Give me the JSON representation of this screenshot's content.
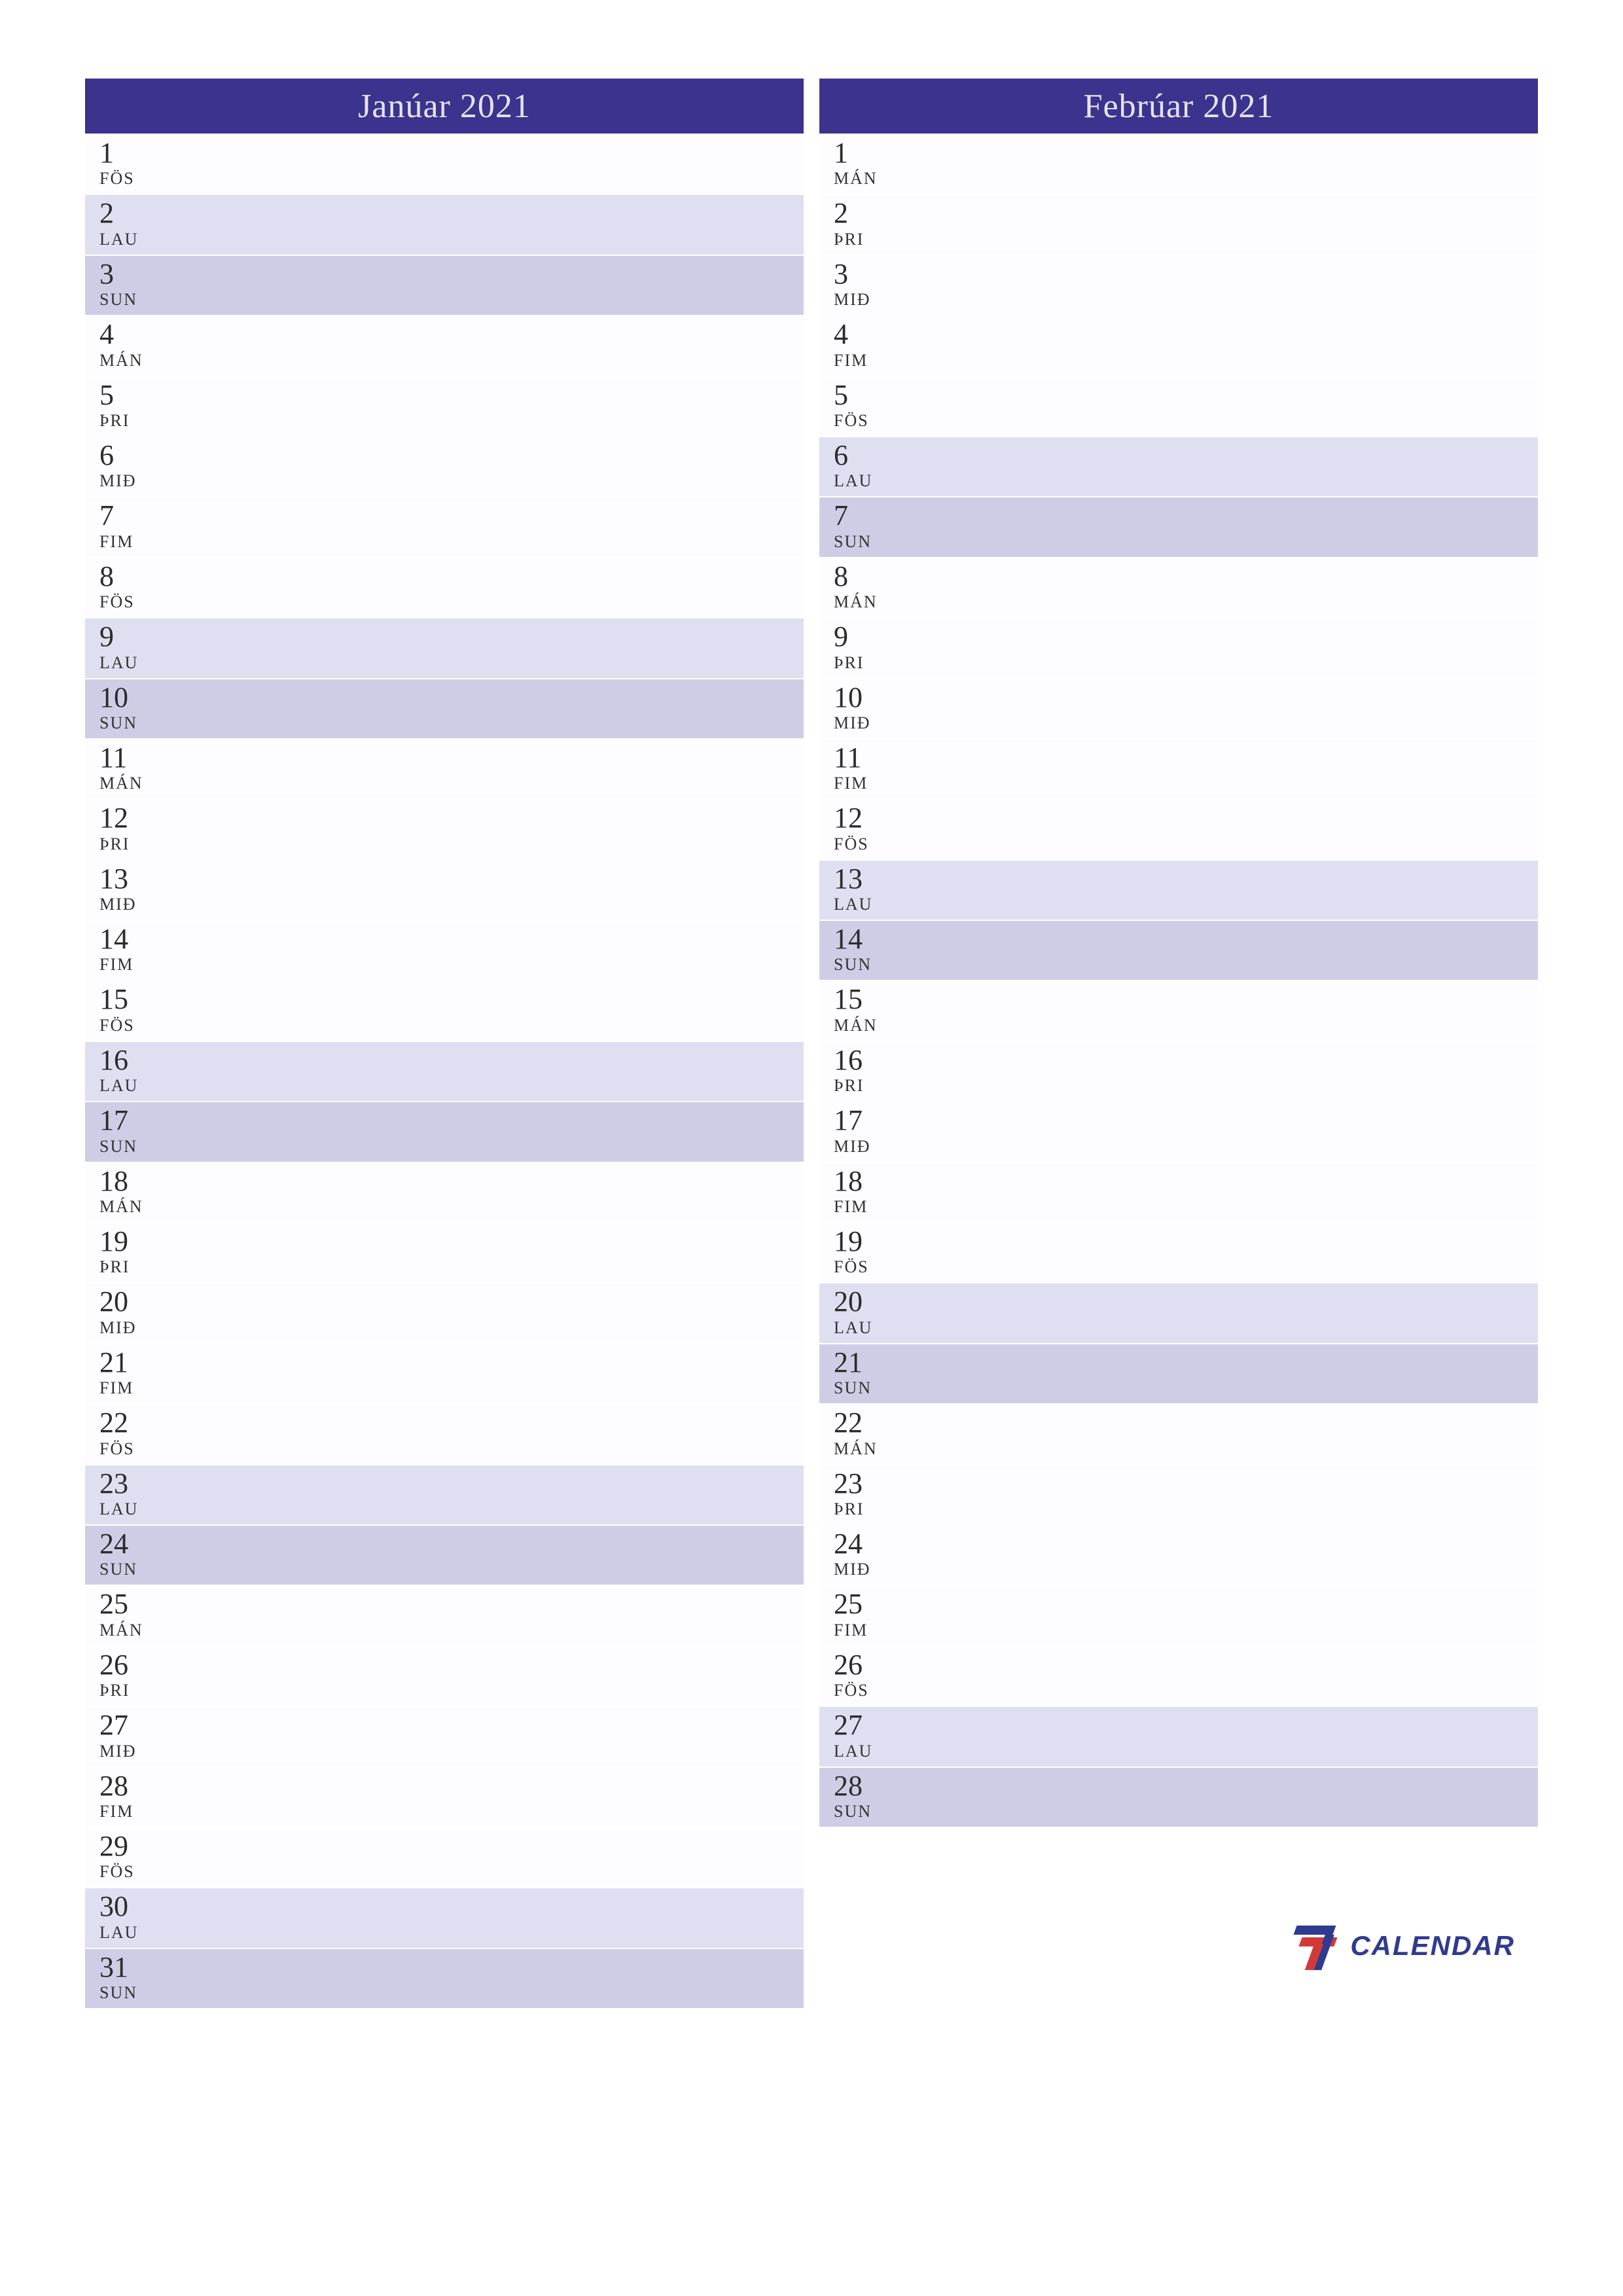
{
  "brand": {
    "text": "CALENDAR"
  },
  "months": [
    {
      "title": "Janúar 2021",
      "days": [
        {
          "num": "1",
          "dow": "FÖS",
          "type": "work"
        },
        {
          "num": "2",
          "dow": "LAU",
          "type": "sat"
        },
        {
          "num": "3",
          "dow": "SUN",
          "type": "sun"
        },
        {
          "num": "4",
          "dow": "MÁN",
          "type": "work"
        },
        {
          "num": "5",
          "dow": "ÞRI",
          "type": "work"
        },
        {
          "num": "6",
          "dow": "MIÐ",
          "type": "work"
        },
        {
          "num": "7",
          "dow": "FIM",
          "type": "work"
        },
        {
          "num": "8",
          "dow": "FÖS",
          "type": "work"
        },
        {
          "num": "9",
          "dow": "LAU",
          "type": "sat"
        },
        {
          "num": "10",
          "dow": "SUN",
          "type": "sun"
        },
        {
          "num": "11",
          "dow": "MÁN",
          "type": "work"
        },
        {
          "num": "12",
          "dow": "ÞRI",
          "type": "work"
        },
        {
          "num": "13",
          "dow": "MIÐ",
          "type": "work"
        },
        {
          "num": "14",
          "dow": "FIM",
          "type": "work"
        },
        {
          "num": "15",
          "dow": "FÖS",
          "type": "work"
        },
        {
          "num": "16",
          "dow": "LAU",
          "type": "sat"
        },
        {
          "num": "17",
          "dow": "SUN",
          "type": "sun"
        },
        {
          "num": "18",
          "dow": "MÁN",
          "type": "work"
        },
        {
          "num": "19",
          "dow": "ÞRI",
          "type": "work"
        },
        {
          "num": "20",
          "dow": "MIÐ",
          "type": "work"
        },
        {
          "num": "21",
          "dow": "FIM",
          "type": "work"
        },
        {
          "num": "22",
          "dow": "FÖS",
          "type": "work"
        },
        {
          "num": "23",
          "dow": "LAU",
          "type": "sat"
        },
        {
          "num": "24",
          "dow": "SUN",
          "type": "sun"
        },
        {
          "num": "25",
          "dow": "MÁN",
          "type": "work"
        },
        {
          "num": "26",
          "dow": "ÞRI",
          "type": "work"
        },
        {
          "num": "27",
          "dow": "MIÐ",
          "type": "work"
        },
        {
          "num": "28",
          "dow": "FIM",
          "type": "work"
        },
        {
          "num": "29",
          "dow": "FÖS",
          "type": "work"
        },
        {
          "num": "30",
          "dow": "LAU",
          "type": "sat"
        },
        {
          "num": "31",
          "dow": "SUN",
          "type": "sun"
        }
      ]
    },
    {
      "title": "Febrúar 2021",
      "days": [
        {
          "num": "1",
          "dow": "MÁN",
          "type": "work"
        },
        {
          "num": "2",
          "dow": "ÞRI",
          "type": "work"
        },
        {
          "num": "3",
          "dow": "MIÐ",
          "type": "work"
        },
        {
          "num": "4",
          "dow": "FIM",
          "type": "work"
        },
        {
          "num": "5",
          "dow": "FÖS",
          "type": "work"
        },
        {
          "num": "6",
          "dow": "LAU",
          "type": "sat"
        },
        {
          "num": "7",
          "dow": "SUN",
          "type": "sun"
        },
        {
          "num": "8",
          "dow": "MÁN",
          "type": "work"
        },
        {
          "num": "9",
          "dow": "ÞRI",
          "type": "work"
        },
        {
          "num": "10",
          "dow": "MIÐ",
          "type": "work"
        },
        {
          "num": "11",
          "dow": "FIM",
          "type": "work"
        },
        {
          "num": "12",
          "dow": "FÖS",
          "type": "work"
        },
        {
          "num": "13",
          "dow": "LAU",
          "type": "sat"
        },
        {
          "num": "14",
          "dow": "SUN",
          "type": "sun"
        },
        {
          "num": "15",
          "dow": "MÁN",
          "type": "work"
        },
        {
          "num": "16",
          "dow": "ÞRI",
          "type": "work"
        },
        {
          "num": "17",
          "dow": "MIÐ",
          "type": "work"
        },
        {
          "num": "18",
          "dow": "FIM",
          "type": "work"
        },
        {
          "num": "19",
          "dow": "FÖS",
          "type": "work"
        },
        {
          "num": "20",
          "dow": "LAU",
          "type": "sat"
        },
        {
          "num": "21",
          "dow": "SUN",
          "type": "sun"
        },
        {
          "num": "22",
          "dow": "MÁN",
          "type": "work"
        },
        {
          "num": "23",
          "dow": "ÞRI",
          "type": "work"
        },
        {
          "num": "24",
          "dow": "MIÐ",
          "type": "work"
        },
        {
          "num": "25",
          "dow": "FIM",
          "type": "work"
        },
        {
          "num": "26",
          "dow": "FÖS",
          "type": "work"
        },
        {
          "num": "27",
          "dow": "LAU",
          "type": "sat"
        },
        {
          "num": "28",
          "dow": "SUN",
          "type": "sun"
        }
      ]
    }
  ]
}
